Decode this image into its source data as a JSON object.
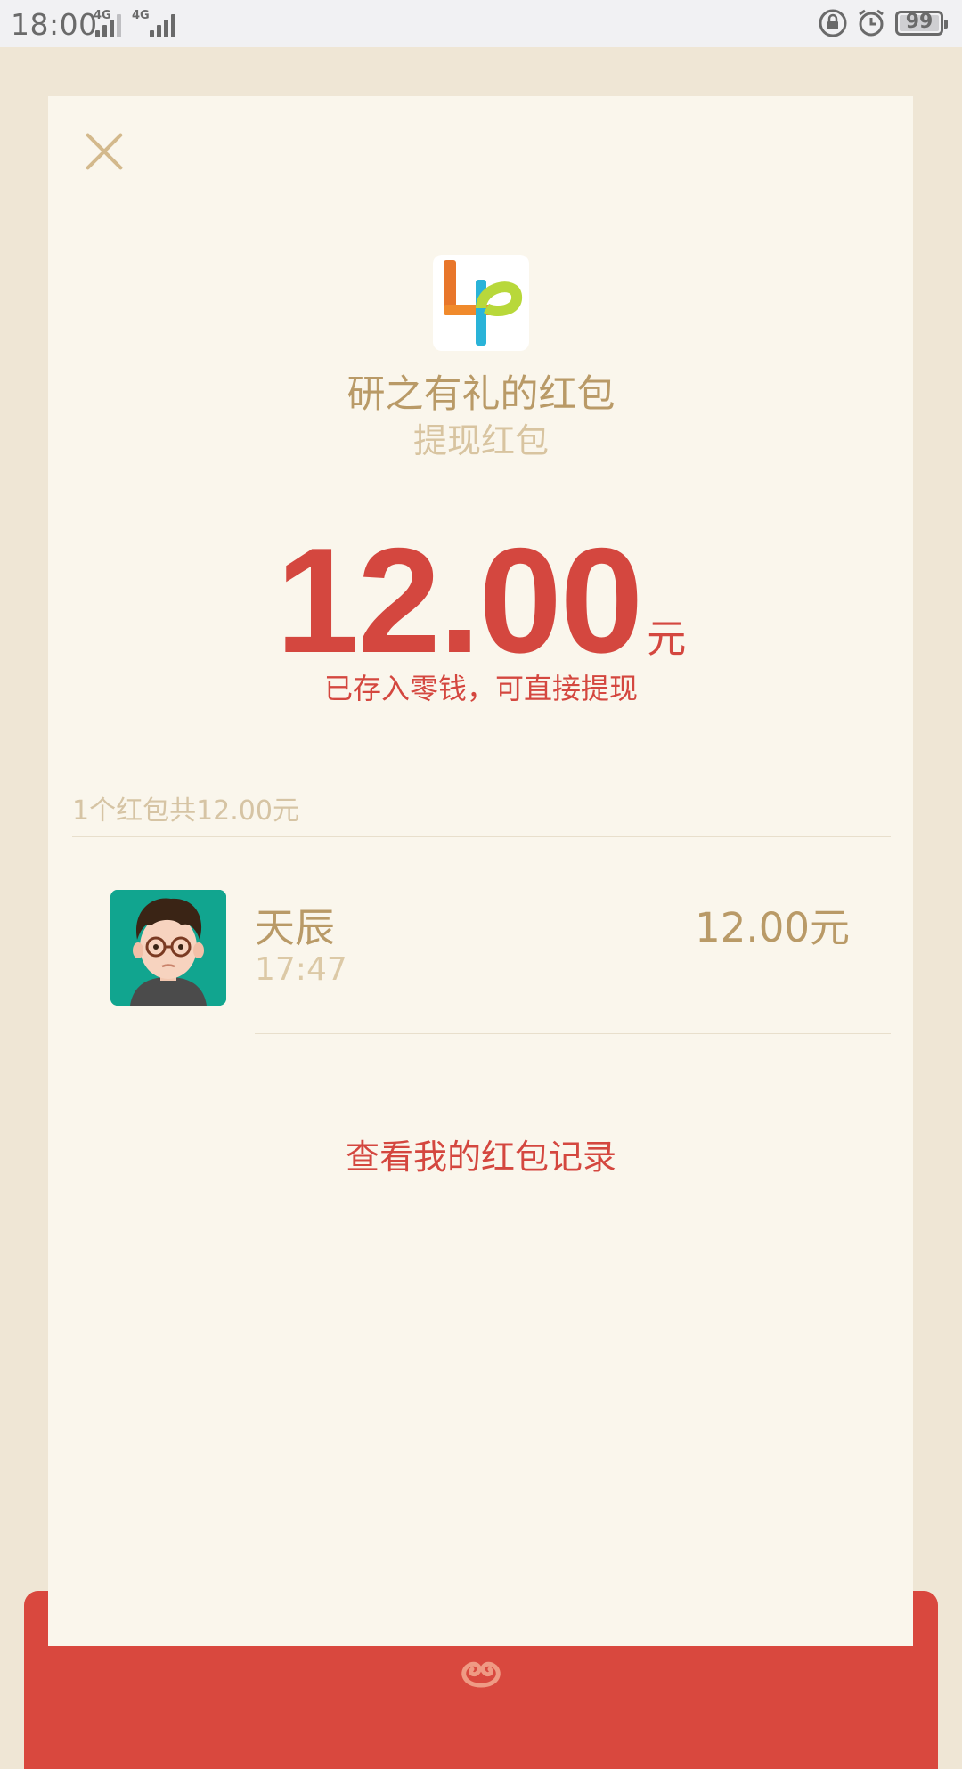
{
  "status_bar": {
    "time": "18:00",
    "network_1": "4G",
    "network_2": "4G",
    "battery": "99"
  },
  "envelope": {
    "sender_title": "研之有礼的红包",
    "subtitle": "提现红包",
    "amount": "12.00",
    "amount_unit": "元",
    "notice": "已存入零钱，可直接提现"
  },
  "summary": "1个红包共12.00元",
  "recipients": [
    {
      "name": "天辰",
      "time": "17:47",
      "amount": "12.00元"
    }
  ],
  "records_link": "查看我的红包记录",
  "colors": {
    "accent_red": "#d4473f",
    "gold_text": "#b99a67",
    "card_bg": "#faf6ec",
    "page_bg": "#efe6d5"
  },
  "icons": [
    "close-icon",
    "app-logo-icon",
    "avatar",
    "envelope-emblem-icon",
    "lock-rotation-icon",
    "alarm-icon",
    "battery-icon",
    "signal-icon"
  ]
}
